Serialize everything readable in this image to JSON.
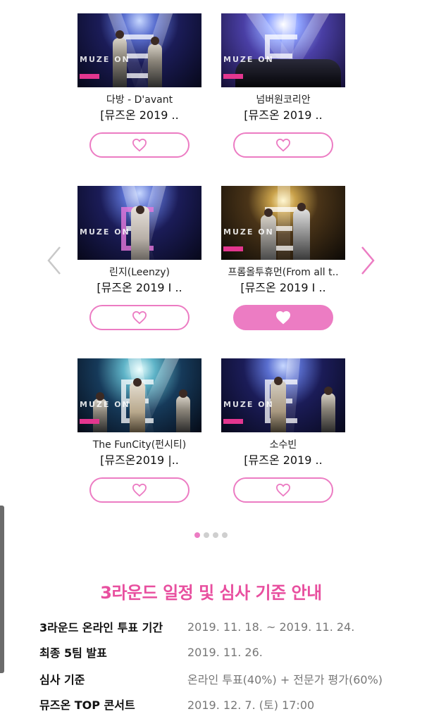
{
  "cards": [
    {
      "artist": "다방 - D'avant",
      "title": "[뮤즈온 2019 ..",
      "liked": false
    },
    {
      "artist": "넘버원코리안",
      "title": "[뮤즈온 2019 ..",
      "liked": false
    },
    {
      "artist": "린지(Leenzy)",
      "title": "[뮤즈온 2019 I ..",
      "liked": false
    },
    {
      "artist": "프롬올투휴먼(From all t..",
      "title": "[뮤즈온 2019 I ..",
      "liked": true
    },
    {
      "artist": "The FunCity(펀시티)",
      "title": "[뮤즈온2019 |..",
      "liked": false
    },
    {
      "artist": "소수빈",
      "title": "[뮤즈온 2019 ..",
      "liked": false
    }
  ],
  "thumb_watermark": "MUZE ON",
  "icons": {
    "like": "heart-icon",
    "prev": "chevron-left-icon",
    "next": "chevron-right-icon"
  },
  "pagination": {
    "count": 4,
    "active_index": 0
  },
  "info": {
    "title": "3라운드 일정 및 심사 기준 안내",
    "rows": [
      {
        "label": "3라운드 온라인 투표 기간",
        "value": "2019. 11. 18. ~ 2019. 11. 24."
      },
      {
        "label": "최종 5팀 발표",
        "value": "2019. 11. 26."
      },
      {
        "label": "심사 기준",
        "value": "온라인 투표(40%) + 전문가 평가(60%)"
      },
      {
        "label": "뮤즈온 TOP 콘서트",
        "value": "2019. 12. 7. (토)  17:00"
      }
    ]
  },
  "colors": {
    "accent": "#ec7cc3",
    "title_pink": "#e84f9f",
    "arrow_gray": "#c8c8c8",
    "arrow_pink": "#ec7cc3",
    "dot_inactive": "#cfcfcf"
  }
}
